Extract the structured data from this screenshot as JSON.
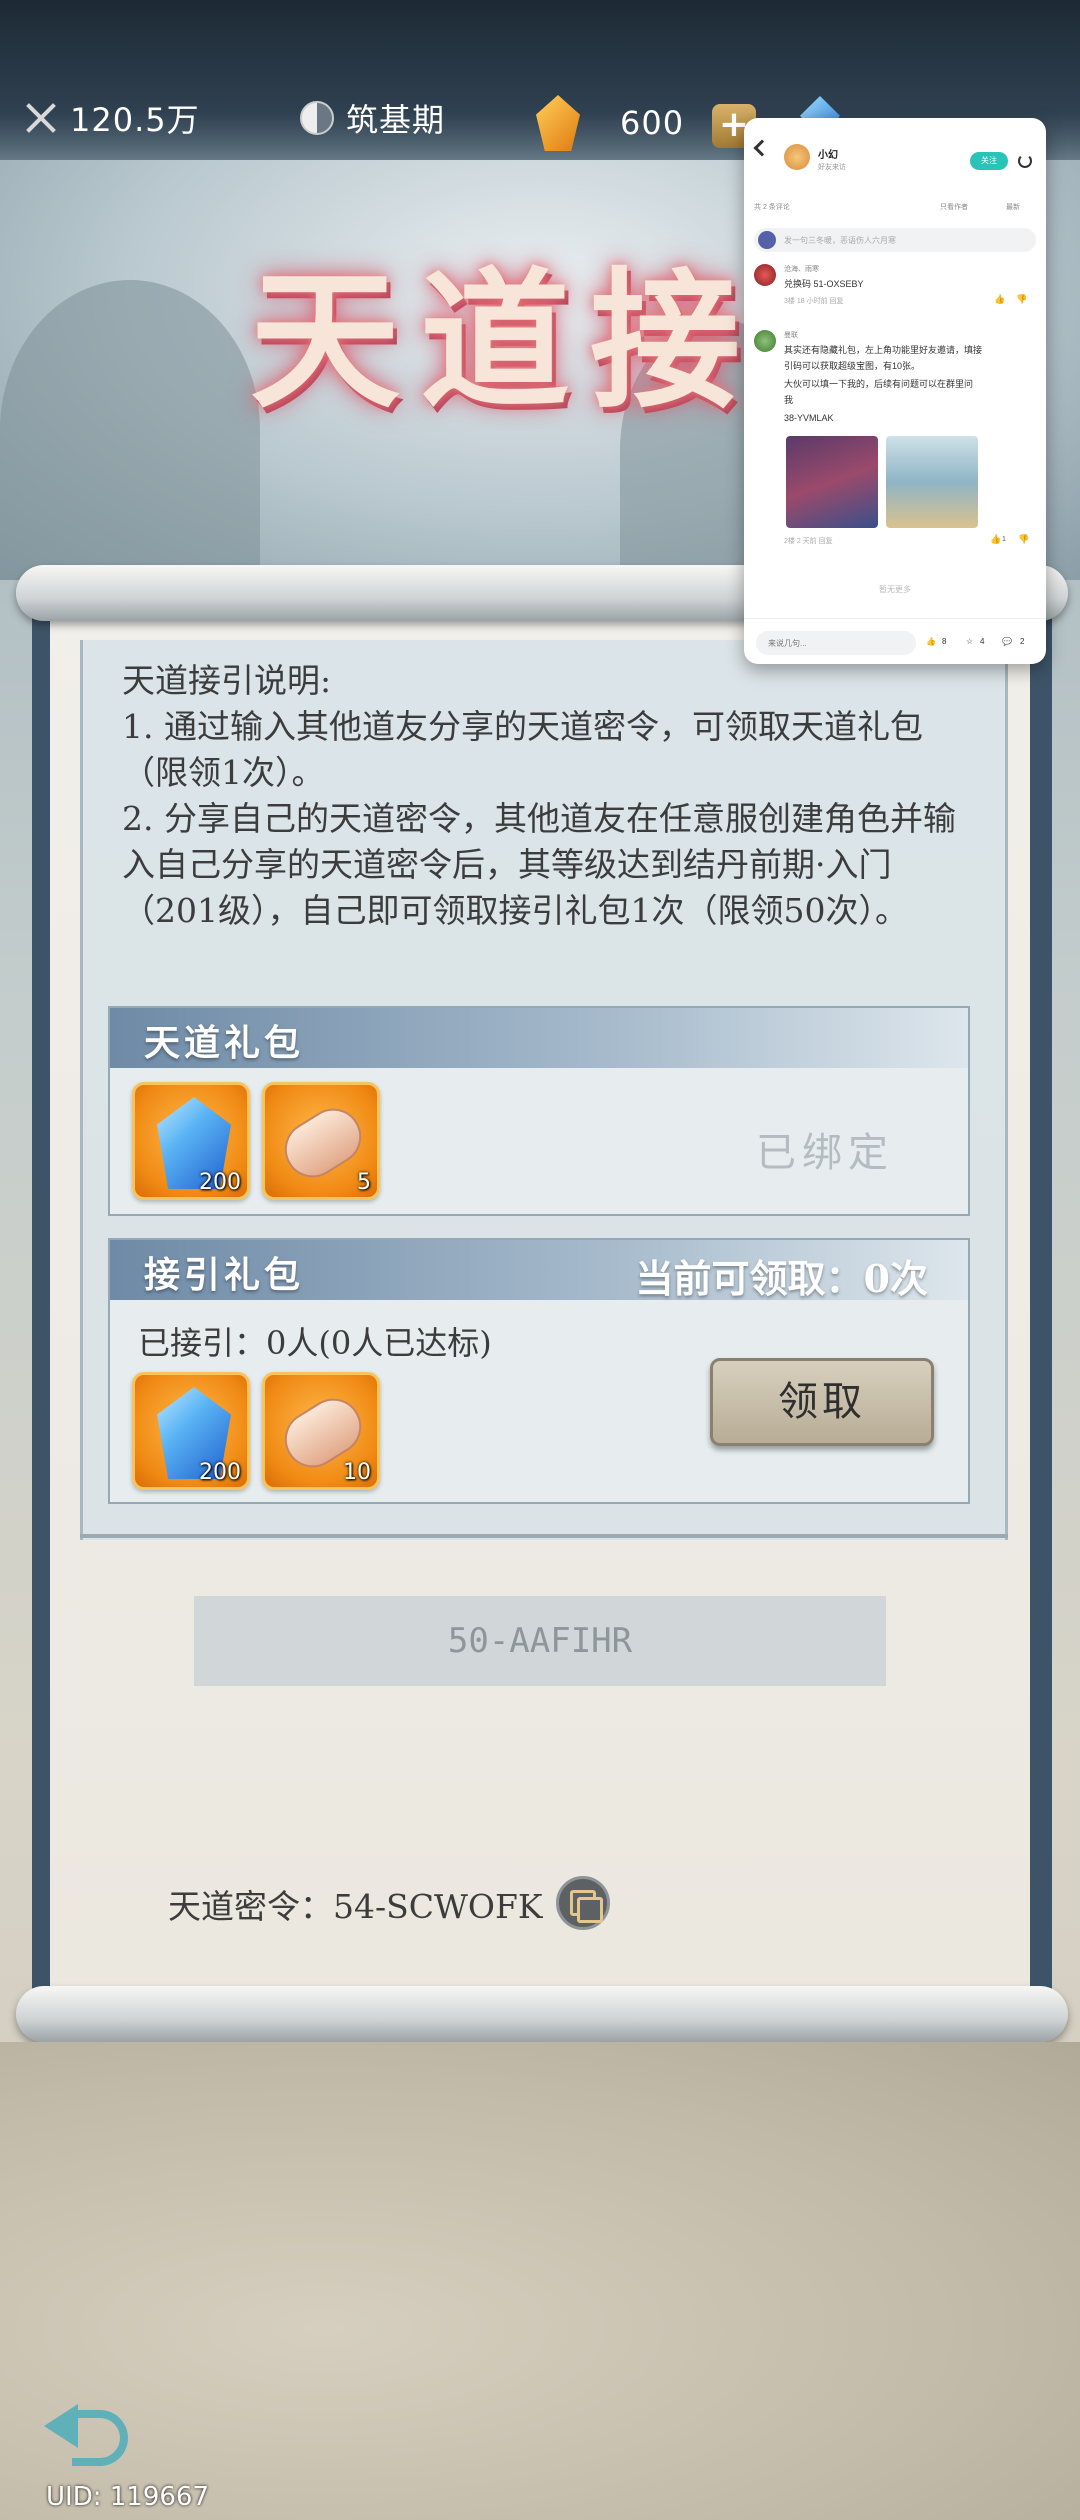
{
  "header": {
    "power": "120.5万",
    "realm": "筑基期",
    "gems": "600",
    "plus_label": "+"
  },
  "banner": {
    "title": "天道接引"
  },
  "description": {
    "heading": "天道接引说明:",
    "line1": "1. 通过输入其他道友分享的天道密令，可领取天道礼包（限领1次）。",
    "line2": "2. 分享自己的天道密令，其他道友在任意服创建角色并输入自己分享的天道密令后，其等级达到结丹前期·入门（201级），自己即可领取接引礼包1次（限领50次）。"
  },
  "tiandao_pack": {
    "title": "天道礼包",
    "items": [
      {
        "icon": "crystal-icon",
        "count": "200"
      },
      {
        "icon": "scroll-item-icon",
        "count": "5"
      }
    ],
    "status": "已绑定"
  },
  "jieyin_pack": {
    "title": "接引礼包",
    "claimable": "当前可领取：0次",
    "invited": "已接引：0人(0人已达标)",
    "items": [
      {
        "icon": "crystal-icon",
        "count": "200"
      },
      {
        "icon": "scroll-item-icon",
        "count": "10"
      }
    ],
    "claim_label": "领取"
  },
  "code_input": {
    "value": "50-AAFIHR"
  },
  "my_code": {
    "text": "天道密令：54-SCWOFK"
  },
  "footer": {
    "uid": "UID: 119667"
  },
  "social_panel": {
    "user_name": "小幻",
    "user_sub": "好友来访",
    "follow_label": "关注",
    "comment_count": "共 2 条评论",
    "filter_author": "只看作者",
    "sort_label": "最新",
    "input_placeholder": "发一句三冬暖，恶语伤人六月寒",
    "comments": [
      {
        "name": "沧海、雨寒",
        "text": "兑换码 51-OXSEBY",
        "time": "3楼  18 小时前  回复"
      },
      {
        "name": "曼联",
        "text1": "其实还有隐藏礼包，左上角功能里好友邀请，填接",
        "text2": "引码可以获取超级宝图，有10张。",
        "text3": "大伙可以填一下我的，后续有问题可以在群里问",
        "text4": "我",
        "code": "38-YVMLAK",
        "time": "2楼  2 天前  回复",
        "likes": "1"
      }
    ],
    "no_more": "暂无更多",
    "comment_prompt": "来说几句...",
    "likes": "8",
    "stars": "4",
    "replies": "2"
  },
  "colors": {
    "accent_teal": "#2ac3b7",
    "item_orange": "#f08a14",
    "pack_header_blue": "#6e8aa6"
  }
}
